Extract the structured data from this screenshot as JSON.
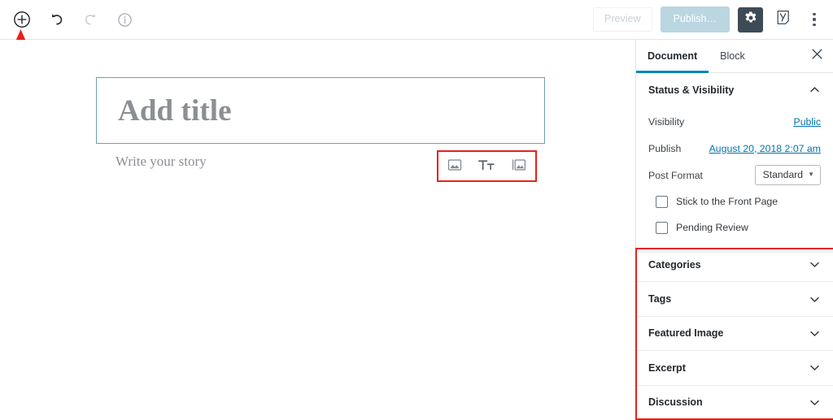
{
  "toolbar": {
    "add_block_label": "Add block",
    "undo_label": "Undo",
    "redo_label": "Redo",
    "info_label": "Content structure",
    "preview_label": "Preview",
    "publish_label": "Publish…",
    "settings_label": "Settings",
    "yoast_label": "Yoast SEO",
    "more_label": "More tools & options",
    "icons": {
      "add_block": "plus-circle-icon",
      "undo": "undo-icon",
      "redo": "redo-icon",
      "info": "info-circle-icon",
      "settings": "gear-icon",
      "yoast": "yoast-logo-icon",
      "more": "kebab-menu-icon"
    }
  },
  "editor": {
    "title_placeholder": "Add title",
    "body_placeholder": "Write your story",
    "quick_inserts": [
      {
        "name": "image-block",
        "icon": "image-icon",
        "label": "Image"
      },
      {
        "name": "paragraph-block",
        "icon": "text-size-icon",
        "label": "Tт"
      },
      {
        "name": "gallery-block",
        "icon": "gallery-icon",
        "label": "Gallery"
      }
    ]
  },
  "sidebar": {
    "tabs": [
      {
        "label": "Document",
        "active": true
      },
      {
        "label": "Block",
        "active": false
      }
    ],
    "close_label": "Close settings",
    "status_panel": {
      "title": "Status & Visibility",
      "expanded": true,
      "rows": [
        {
          "label": "Visibility",
          "value": "Public",
          "type": "link"
        },
        {
          "label": "Publish",
          "value": "August 20, 2018 2:07 am",
          "type": "link"
        },
        {
          "label": "Post Format",
          "value": "Standard",
          "type": "select"
        }
      ],
      "checkboxes": [
        {
          "label": "Stick to the Front Page",
          "checked": false
        },
        {
          "label": "Pending Review",
          "checked": false
        }
      ]
    },
    "collapsed_panels": [
      {
        "title": "Categories"
      },
      {
        "title": "Tags"
      },
      {
        "title": "Featured Image"
      },
      {
        "title": "Excerpt"
      },
      {
        "title": "Discussion"
      }
    ]
  },
  "annotations": {
    "arrow_color": "#e8211b",
    "highlight_color": "#e8211b",
    "arrow_target": "add-block-button",
    "highlight_targets": [
      "quick-insert-toolbar",
      "collapsed-panel-group"
    ]
  },
  "colors": {
    "accent_blue": "#0085ba",
    "link_blue": "#0073aa",
    "publish_bg": "#aecfdc",
    "gear_bg": "#3e4b56",
    "title_border": "#6f9fb3",
    "annotation_red": "#e8211b"
  }
}
